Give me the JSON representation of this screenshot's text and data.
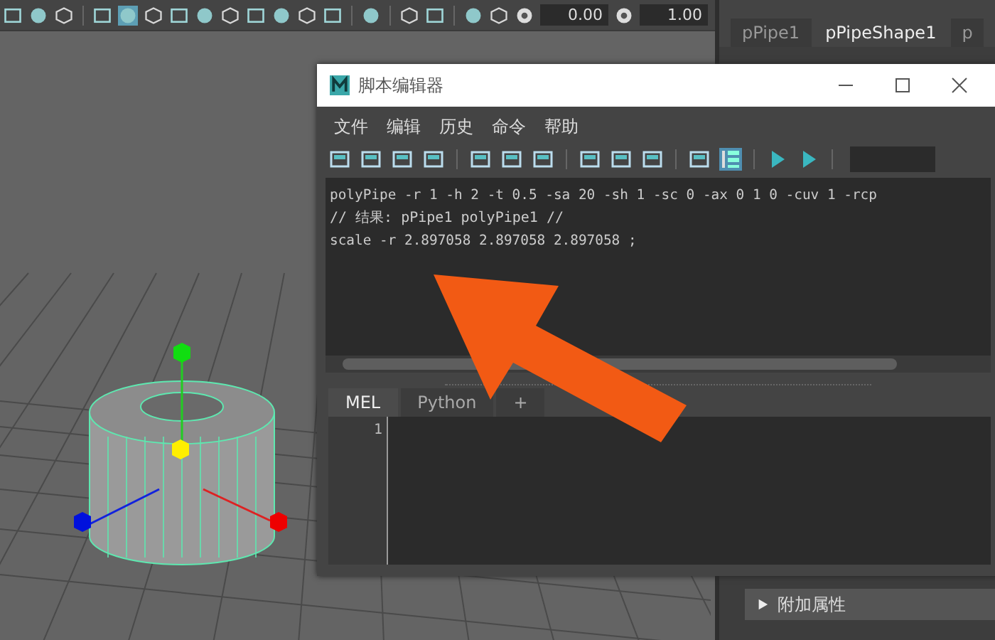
{
  "status_line": {
    "fields": [
      {
        "value": "0.00"
      },
      {
        "value": "1.00"
      }
    ]
  },
  "attribute_editor": {
    "tabs": [
      {
        "label": "pPipe1",
        "selected": false
      },
      {
        "label": "pPipeShape1",
        "selected": true
      },
      {
        "label": "p",
        "selected": false
      }
    ],
    "section": {
      "label": "附加属性",
      "expanded": false
    }
  },
  "script_editor": {
    "title": "脚本编辑器",
    "menu": [
      "文件",
      "编辑",
      "历史",
      "命令",
      "帮助"
    ],
    "line_numbers_on": true,
    "history": [
      {
        "text": "polyPipe -r 1 -h 2 -t 0.5 -sa 20 -sh 1 -sc 0 -ax 0 1 0 -cuv 1 -rcp"
      },
      {
        "text": "// 结果: pPipe1 polyPipe1 //"
      },
      {
        "text": "scale -r 2.897058 2.897058 2.897058 ;"
      }
    ],
    "input_tabs": [
      {
        "label": "MEL",
        "selected": true
      },
      {
        "label": "Python",
        "selected": false
      },
      {
        "label": "+",
        "selected": false
      }
    ],
    "line_numbers": [
      "1"
    ]
  }
}
